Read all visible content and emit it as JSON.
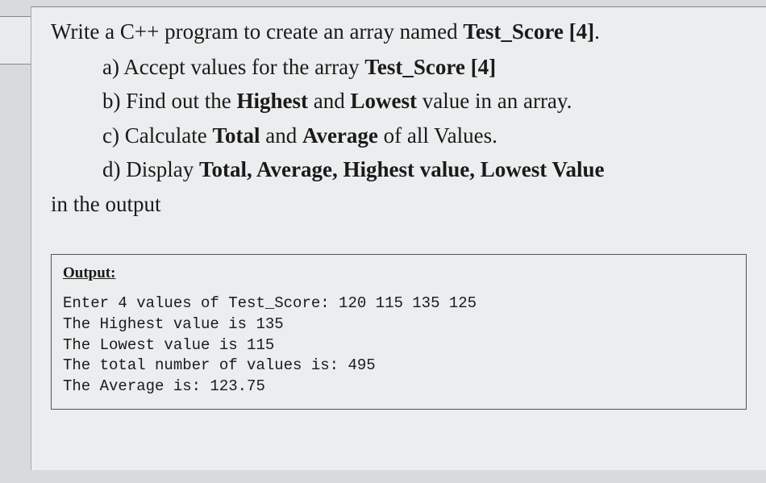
{
  "intro": {
    "prefix": "Write a C++ program to create an array named ",
    "array_name": "Test_Score [4]",
    "suffix": "."
  },
  "questions": {
    "a": {
      "label": "a) ",
      "text": "Accept values for the array ",
      "bold": "Test_Score [4]"
    },
    "b": {
      "label": "b) ",
      "text1": "Find out the ",
      "bold1": "Highest",
      "text2": " and ",
      "bold2": "Lowest",
      "text3": " value in an array."
    },
    "c": {
      "label": "c) ",
      "text1": "Calculate ",
      "bold1": "Total",
      "text2": " and ",
      "bold2": "Average",
      "text3": " of all Values."
    },
    "d": {
      "label": "d) ",
      "text1": "Display ",
      "bold1": "Total, Average, Highest value, Lowest Value"
    },
    "d_continuation": "in the output"
  },
  "output": {
    "header": "Output:",
    "line1": "Enter 4 values of Test_Score: 120 115 135 125",
    "line2": "The Highest value is 135",
    "line3": "The Lowest value is 115",
    "line4": "The total number of values is: 495",
    "line5": "The Average is: 123.75"
  }
}
